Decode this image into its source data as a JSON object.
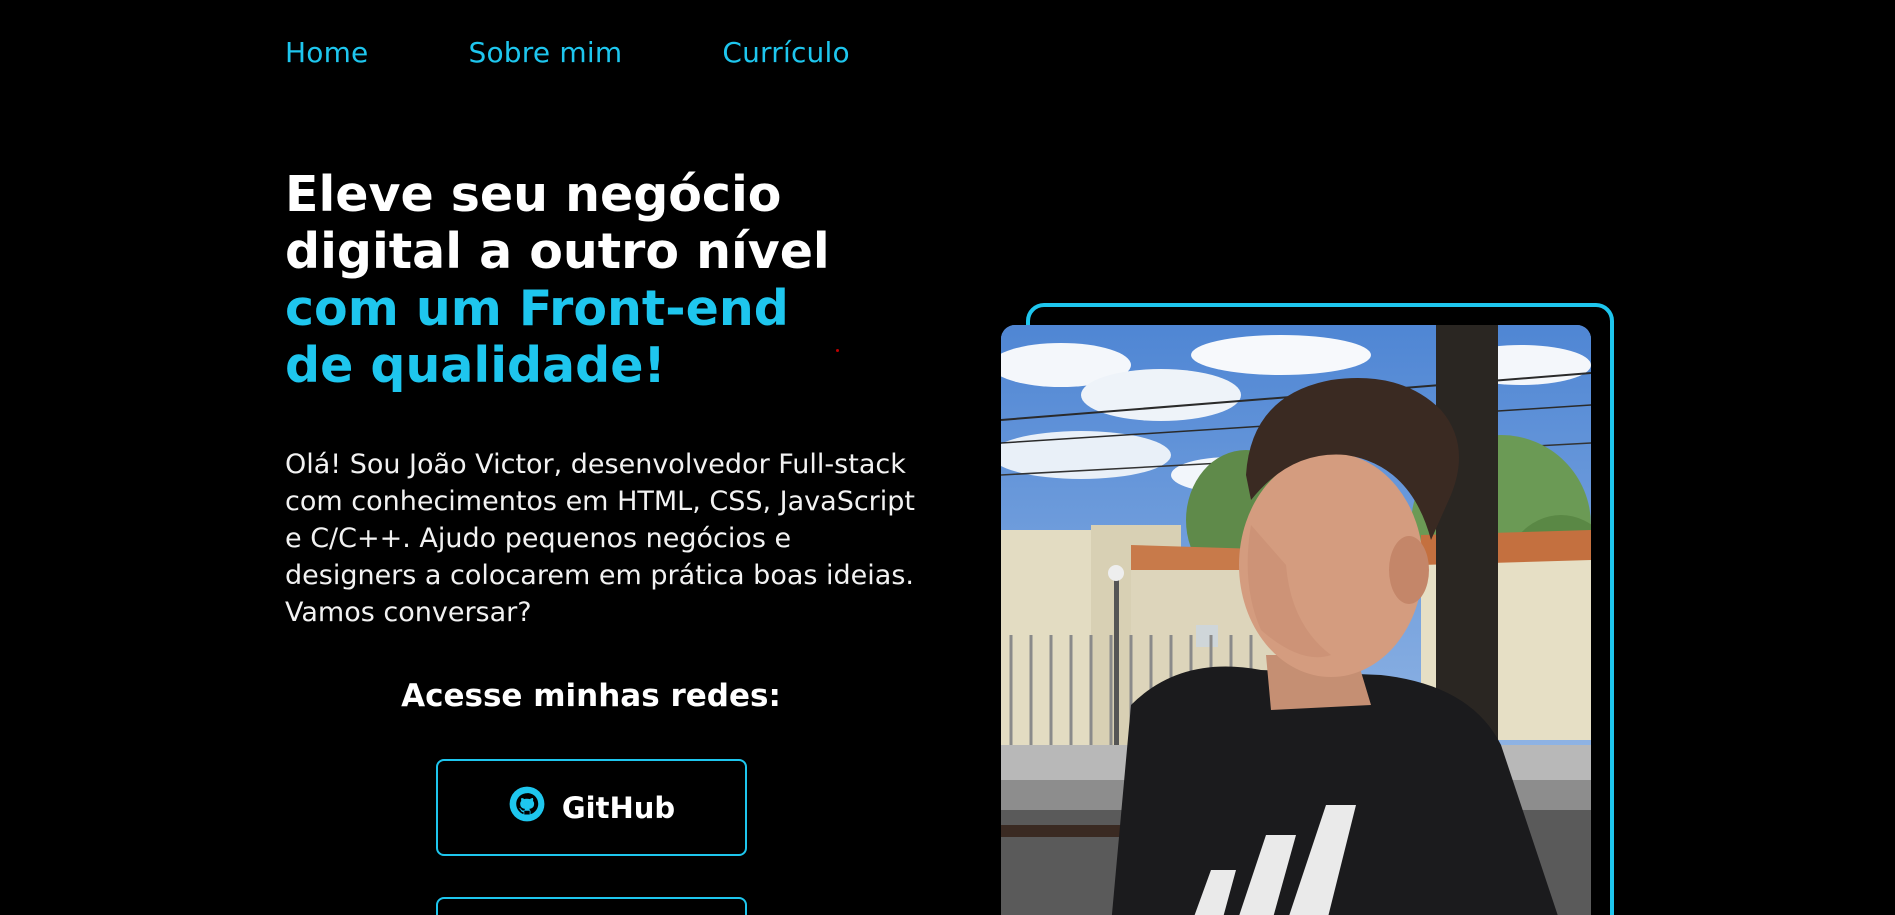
{
  "nav": {
    "items": [
      {
        "label": "Home"
      },
      {
        "label": "Sobre mim"
      },
      {
        "label": "Currículo"
      }
    ]
  },
  "hero": {
    "headline_line1": "Eleve seu negócio",
    "headline_line2": "digital a outro nível",
    "headline_accent_line1": "com um Front-end",
    "headline_accent_line2": "de qualidade!",
    "intro": "Olá! Sou João Victor, desenvolvedor Full-stack com conhecimentos em HTML, CSS, JavaScript e C/C++. Ajudo pequenos negócios e designers a colocarem em prática boas ideias. Vamos conversar?"
  },
  "social": {
    "title": "Acesse minhas redes:",
    "buttons": [
      {
        "label": "GitHub",
        "icon": "github-icon"
      }
    ]
  },
  "colors": {
    "background": "#000000",
    "accent": "#1ec6ee",
    "text": "#ffffff"
  },
  "photo": {
    "icon": "profile-photo"
  }
}
